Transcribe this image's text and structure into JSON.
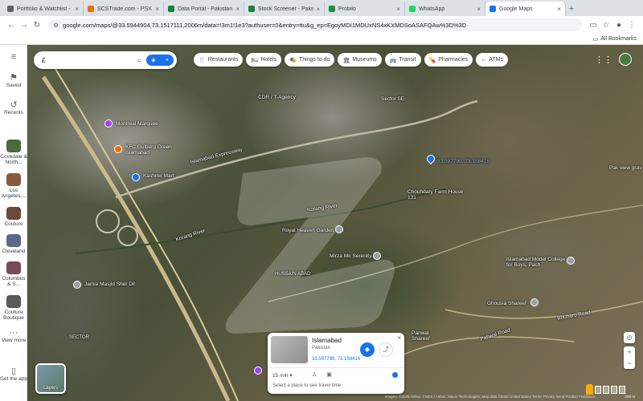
{
  "browser": {
    "tabs": [
      {
        "label": "Portfolio & Watchlist - In",
        "color": "#5f6368",
        "active": false
      },
      {
        "label": "SCSTrade.com - PSX Li...",
        "color": "#e8710a",
        "active": false
      },
      {
        "label": "Data Portal - Pakistan St...",
        "color": "#188038",
        "active": false
      },
      {
        "label": "Stock Screener - Pakista",
        "color": "#188038",
        "active": false
      },
      {
        "label": "Probilo",
        "color": "#1e8e3e",
        "active": false
      },
      {
        "label": "WhatsApp",
        "color": "#25d366",
        "active": false
      },
      {
        "label": "Google Maps",
        "color": "#1a73e8",
        "active": true
      }
    ],
    "url": "google.com/maps/@33.5944904,73.1517111,2006m/data=!3m1!1e3?authuser=0&entry=ttu&g_ep=EgoyMDI1MDUxNS4xKXMDSoASAFQAw%3D%3D",
    "bookmarks_label": "All Bookmarks"
  },
  "sidebar": {
    "menu_icon": "menu-icon",
    "items": [
      {
        "label": "Saved",
        "icon": "bookmark-icon"
      },
      {
        "label": "Recents",
        "icon": "history-icon"
      }
    ],
    "recents": [
      {
        "label": "Covedale & North...",
        "color": "#4a6a3a"
      },
      {
        "label": "Los Angeles,...",
        "color": "#8a5a3a"
      },
      {
        "label": "Couture",
        "color": "#6a4a3a"
      },
      {
        "label": "Cleveland",
        "color": "#5a6a8a"
      },
      {
        "label": "Columbus & S...",
        "color": "#7a4a5a"
      },
      {
        "label": "Couture Boutique",
        "color": "#5a5a5a"
      }
    ],
    "view_more": "View more",
    "get_app": "Get the app"
  },
  "search": {
    "value": "£",
    "search_icon": "search-icon",
    "directions_icon": "directions-icon"
  },
  "chips": [
    {
      "label": "Restaurants",
      "icon": "🍴"
    },
    {
      "label": "Hotels",
      "icon": "🛏"
    },
    {
      "label": "Things to do",
      "icon": "🎭"
    },
    {
      "label": "Museums",
      "icon": "🏛"
    },
    {
      "label": "Transit",
      "icon": "🚌"
    },
    {
      "label": "Pharmacies",
      "icon": "💊"
    },
    {
      "label": "ATMs",
      "icon": "↔"
    }
  ],
  "map_labels": {
    "montreal_marquee": "Montreal Marquee",
    "kfc": "KFC Gulberg Green Islamabad",
    "kashmir_mart": "Kashmir Mart",
    "cdr": "CDR / T-Agency",
    "spectrum": "Sector SE",
    "coords_pin": "33.597799, 73.158416",
    "chouhdary_farm": "Chouhdary Farm House 131",
    "korang_river_1": "Korang River",
    "korang_river_2": "Korang River",
    "royal_heaven": "Royal Heaven Garden",
    "mirza_mir": "Mirza Mir Serenity",
    "hussain_abad": "HUSSAIN ABAD",
    "jamia_masjid": "Jamia Masjid Sher Dil",
    "islamabad_college": "Islamabad Model College for Boys, Pach",
    "ghousia_shareef": "Ghousia Shareef",
    "panwal_shareef": "Panwal Shareef",
    "bhoharo_road": "Bhoharo Road",
    "panwal_road": "Pahwal Road",
    "express_hwy": "Islamabad Expressway",
    "sector": "SECTOR",
    "pak_view": "Pak view grav"
  },
  "layers_label": "Layers",
  "info_card": {
    "title": "Islamabad",
    "subtitle": "Pakistan",
    "coords": "33.597799, 73.158416",
    "travel_time": "15 min",
    "hint": "Select a place to see travel time",
    "directions_icon": "directions-icon",
    "share_icon": "share-icon",
    "close_icon": "close-icon"
  },
  "footer": "Imagery ©2025 Airbus, CNES / Airbus, Maxar Technologies, Map data ©2025   United States   Terms   Privacy   Send Product Feedback",
  "scale": "200 m"
}
